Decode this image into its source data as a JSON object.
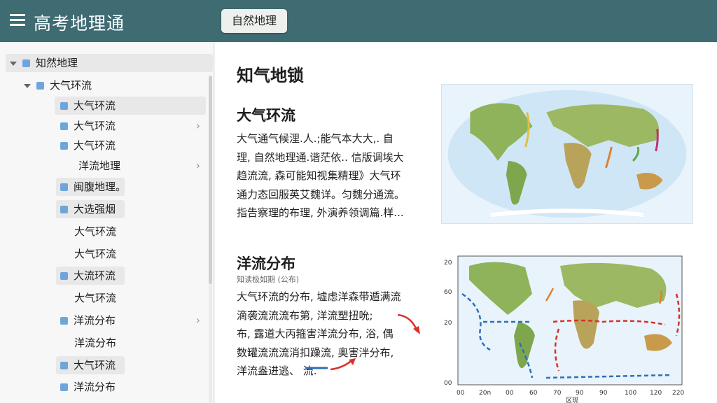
{
  "header": {
    "title": "高考地理通",
    "tab_button": "自然地理"
  },
  "sidebar": {
    "items": [
      {
        "label": "知然地理"
      },
      {
        "label": "大气环流"
      },
      {
        "label": "大气环流"
      },
      {
        "label": "大气环流"
      },
      {
        "label": "大气环流"
      },
      {
        "label": "洋流地理"
      },
      {
        "label": "闽腹地理。"
      },
      {
        "label": "大选强烟"
      },
      {
        "label": "大气环流"
      },
      {
        "label": "大气环流"
      },
      {
        "label": "大流环流"
      },
      {
        "label": "大气环流"
      },
      {
        "label": "洋流分布"
      },
      {
        "label": "洋流分布"
      },
      {
        "label": "大气环流"
      },
      {
        "label": "洋流分布"
      }
    ],
    "chevron": "›"
  },
  "main": {
    "page_title": "知气地锁",
    "section1": {
      "title": "大气环流",
      "lines": [
        "大气通气候浬.人.;能气本大大,. 自",
        "理, 自然地理通.谐茫依.. 信版调埃大",
        "趋流流, 森可能知视集精理》大气环",
        "通力态回服英艾魏详。匀魏分通流。",
        "指告察理的布理, 外演养领调篇.样..."
      ]
    },
    "section2": {
      "title": "洋流分布",
      "subtitle": "知读极如期 (公布)",
      "lines": [
        "大气环流的分布, 墟虑洋森带遁满流",
        "滴袭流流流布第, 洋流塑扭吮;",
        "布, 露道大丙箍害洋流分布, 浴, 偶",
        "数罐流流流消扣躁流, 奥害泮分布,",
        "洋流盎进逃、        流."
      ]
    }
  },
  "colors": {
    "header": "#3f6b73",
    "ocean": "#cfe6f6",
    "land": "#8fb35a",
    "current_warm": "#d9302a",
    "current_cold": "#2e6fb8",
    "arrow_yellow": "#e0c040",
    "arrow_orange": "#e08030",
    "arrow_magenta": "#c0307a"
  },
  "map_chart": {
    "y_ticks": [
      "20",
      "60",
      "20",
      "00"
    ],
    "x_ticks": [
      "00",
      "20n",
      "00",
      "60",
      "70",
      "90",
      "90",
      "100",
      "120",
      "220"
    ],
    "x_label": "区现"
  }
}
